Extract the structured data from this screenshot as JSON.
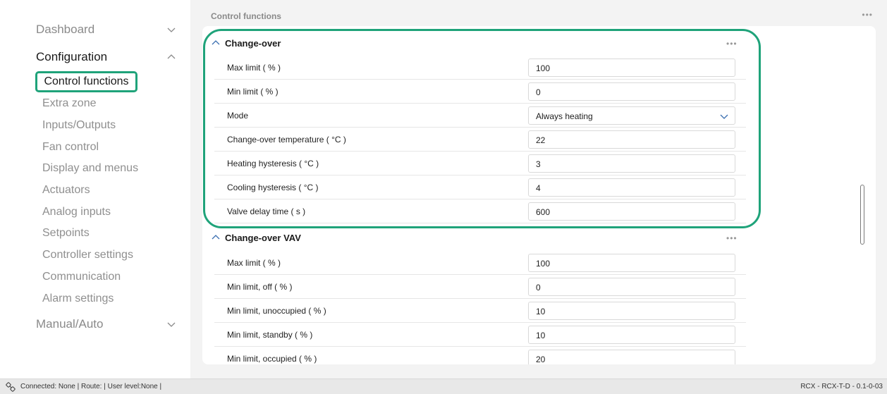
{
  "sidebar": {
    "groups": [
      {
        "label": "Dashboard"
      },
      {
        "label": "Configuration"
      },
      {
        "label": "Manual/Auto"
      }
    ],
    "items": [
      {
        "label": "Control functions"
      },
      {
        "label": "Extra zone"
      },
      {
        "label": "Inputs/Outputs"
      },
      {
        "label": "Fan control"
      },
      {
        "label": "Display and menus"
      },
      {
        "label": "Actuators"
      },
      {
        "label": "Analog inputs"
      },
      {
        "label": "Setpoints"
      },
      {
        "label": "Controller settings"
      },
      {
        "label": "Communication"
      },
      {
        "label": "Alarm settings"
      }
    ]
  },
  "main": {
    "title": "Control functions",
    "more": "•••",
    "sections": [
      {
        "title": "Change-over",
        "more": "•••",
        "rows": [
          {
            "label": "Max limit ( % )",
            "value": "100"
          },
          {
            "label": "Min limit ( % )",
            "value": "0"
          },
          {
            "label": "Mode",
            "value": "Always heating"
          },
          {
            "label": "Change-over temperature ( °C )",
            "value": "22"
          },
          {
            "label": "Heating hysteresis ( °C )",
            "value": "3"
          },
          {
            "label": "Cooling hysteresis ( °C )",
            "value": "4"
          },
          {
            "label": "Valve delay time ( s )",
            "value": "600"
          }
        ]
      },
      {
        "title": "Change-over VAV",
        "more": "•••",
        "rows": [
          {
            "label": "Max limit ( % )",
            "value": "100"
          },
          {
            "label": "Min limit, off ( % )",
            "value": "0"
          },
          {
            "label": "Min limit, unoccupied ( % )",
            "value": "10"
          },
          {
            "label": "Min limit, standby ( % )",
            "value": "10"
          },
          {
            "label": "Min limit, occupied ( % )",
            "value": "20"
          }
        ]
      }
    ]
  },
  "status": {
    "text": "Connected: None | Route: | User level:None |",
    "version": "RCX - RCX-T-D - 0.1-0-03",
    "icon": "connection-icon"
  },
  "colors": {
    "accent": "#1fa37a",
    "background": "#f3f3f3"
  }
}
